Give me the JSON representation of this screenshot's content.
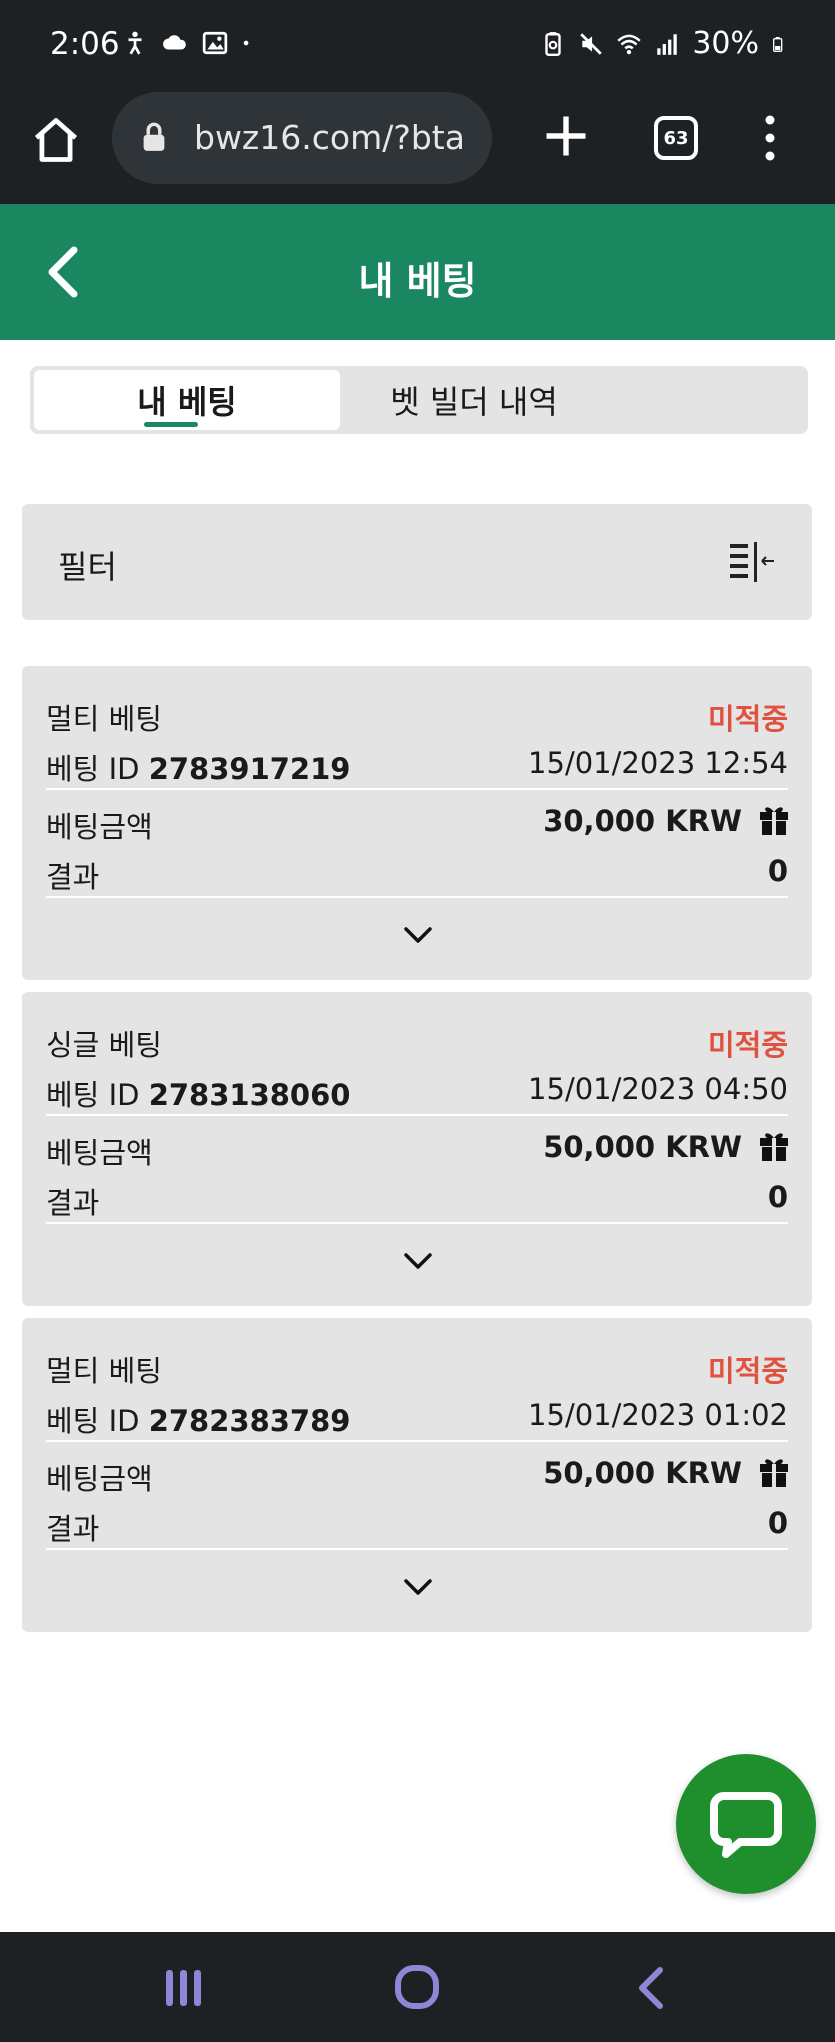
{
  "status_bar": {
    "time": "2:06",
    "battery": "30%",
    "left_icons": [
      "accessibility-icon",
      "cloud-icon",
      "image-icon",
      "dot-icon"
    ],
    "right_icons": [
      "battery-saver-icon",
      "mute-icon",
      "wifi-icon",
      "signal-icon",
      "battery-icon"
    ]
  },
  "browser": {
    "url": "bwz16.com/?bta",
    "tab_count": "63"
  },
  "header": {
    "title": "내 베팅"
  },
  "tabs": [
    {
      "label": "내 베팅",
      "active": true
    },
    {
      "label": "벳 빌더 내역",
      "active": false
    }
  ],
  "filter": {
    "label": "필터"
  },
  "bets": [
    {
      "type": "멀티 베팅",
      "status": "미적중",
      "id_label": "베팅 ID",
      "id": "2783917219",
      "date": "15/01/2023 12:54",
      "amount_label": "베팅금액",
      "amount": "30,000 KRW",
      "result_label": "결과",
      "result": "0"
    },
    {
      "type": "싱글 베팅",
      "status": "미적중",
      "id_label": "베팅 ID",
      "id": "2783138060",
      "date": "15/01/2023 04:50",
      "amount_label": "베팅금액",
      "amount": "50,000 KRW",
      "result_label": "결과",
      "result": "0"
    },
    {
      "type": "멀티 베팅",
      "status": "미적중",
      "id_label": "베팅 ID",
      "id": "2782383789",
      "date": "15/01/2023 01:02",
      "amount_label": "베팅금액",
      "amount": "50,000 KRW",
      "result_label": "결과",
      "result": "0"
    }
  ],
  "colors": {
    "header_green": "#1b8760",
    "status_red": "#e0523f",
    "chat_green": "#1f8f2e",
    "system_bar": "#1e2124"
  }
}
